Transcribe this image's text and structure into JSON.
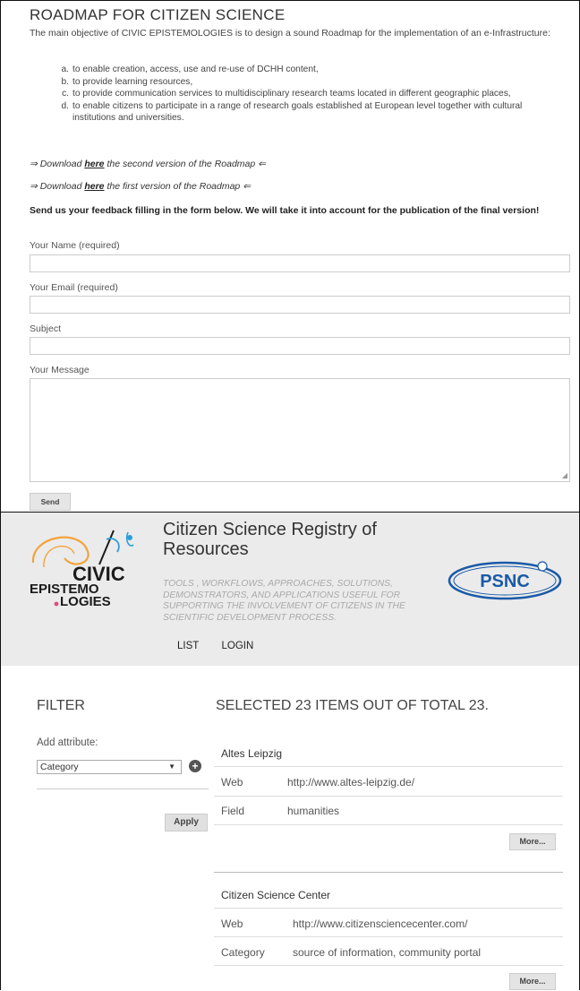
{
  "roadmap": {
    "title": "ROADMAP FOR CITIZEN SCIENCE",
    "intro": "The main objective of CIVIC EPISTEMOLOGIES is to design a sound Roadmap for the implementation of an e-Infrastructure:",
    "objectives": [
      {
        "letter": "a.",
        "text": "to enable creation, access, use and re-use of DCHH content,"
      },
      {
        "letter": "b.",
        "text": "to provide learning resources,"
      },
      {
        "letter": "c.",
        "text": "to provide communication services to multidisciplinary research teams located in different geographic places,"
      },
      {
        "letter": "d.",
        "text": "to enable citizens to participate in a range of research goals established at European level together with cultural institutions and universities."
      }
    ],
    "downloads": [
      {
        "prefix": "⇒ Download ",
        "link": "here",
        "suffix": " the second version of the Roadmap ⇐"
      },
      {
        "prefix": "⇒ Download ",
        "link": "here",
        "suffix": " the first version of the Roadmap ⇐"
      }
    ],
    "feedback": "Send us your feedback filling in the form below. We will take it into account for the publication of the final version!",
    "form": {
      "name_label": "Your Name (required)",
      "email_label": "Your Email (required)",
      "subject_label": "Subject",
      "message_label": "Your Message",
      "send_label": "Send"
    }
  },
  "registry": {
    "logo_text": [
      "CIVIC",
      "EPISTEMO",
      "LOGIES"
    ],
    "title": "Citizen Science Registry of Resources",
    "tagline": "TOOLS , WORKFLOWS, APPROACHES, SOLUTIONS, DEMONSTRATORS, AND APPLICATIONS USEFUL FOR SUPPORTING THE INVOLVEMENT OF CITIZENS IN THE SCIENTIFIC DEVELOPMENT PROCESS.",
    "partner_logo": "PSNC",
    "nav": [
      "LIST",
      "LOGIN"
    ],
    "filter": {
      "heading": "FILTER",
      "add_attribute_label": "Add attribute:",
      "selected_attribute": "Category",
      "apply_label": "Apply"
    },
    "results_heading": "SELECTED 23 ITEMS OUT OF TOTAL 23.",
    "items": [
      {
        "name": "Altes Leipzig",
        "fields": [
          {
            "key": "Web",
            "value": "http://www.altes-leipzig.de/"
          },
          {
            "key": "Field",
            "value": "humanities"
          }
        ],
        "more_label": "More..."
      },
      {
        "name": "Citizen Science Center",
        "fields": [
          {
            "key": "Web",
            "value": "http://www.citizensciencecenter.com/"
          },
          {
            "key": "Category",
            "value": "source of information, community portal"
          }
        ],
        "more_label": "More..."
      }
    ]
  },
  "colors": {
    "logo_orange": "#f3a33a",
    "logo_blue": "#2c9fd9",
    "logo_dark": "#1b1b1b",
    "logo_pink": "#e2497f",
    "psnc_blue": "#1a5aa7",
    "header_bg": "#ebebeb"
  }
}
